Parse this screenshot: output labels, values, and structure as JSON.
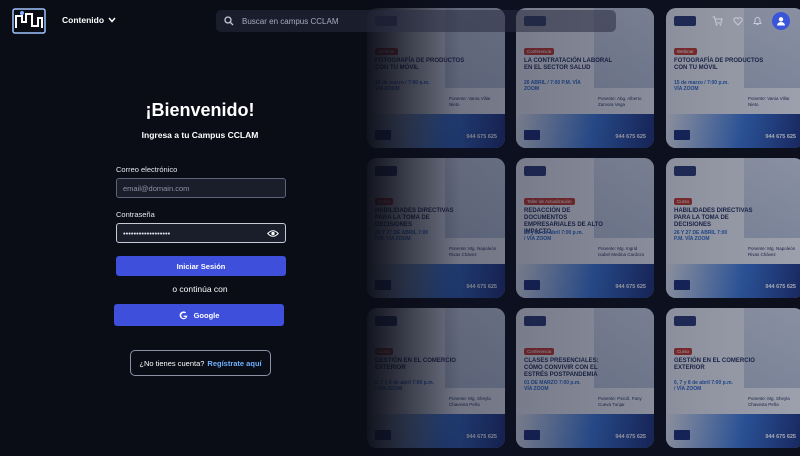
{
  "header": {
    "menu_label": "Contenido",
    "search_placeholder": "Buscar en campus CCLAM"
  },
  "login": {
    "title": "¡Bienvenido!",
    "subtitle": "Ingresa a tu Campus CCLAM",
    "email_label": "Correo electrónico",
    "email_placeholder": "email@domain.com",
    "password_label": "Contraseña",
    "password_value": "••••••••••••••••••",
    "submit_label": "Iniciar Sesión",
    "or_label": "o continúa con",
    "google_label": "Google",
    "signup_prompt": "¿No tienes cuenta?",
    "signup_link": "Regístrate aquí"
  },
  "cards": [
    {
      "tag": "Webinar",
      "title": "FOTOGRAFÍA DE PRODUCTOS CON TU MÓVIL",
      "date": "15 de marzo / 7:00 p.m. VÍA ZOOM",
      "speaker": "Ponente: Vania Villar Nieto",
      "phone": "944 675 625"
    },
    {
      "tag": "Conferencia",
      "title": "LA CONTRATACIÓN LABORAL EN EL SECTOR SALUD",
      "date": "26 ABRIL / 7:00 P.M. VÍA ZOOM",
      "speaker": "Ponente: Abg. Alberto Zamora Vega",
      "phone": "944 675 625"
    },
    {
      "tag": "Webinar",
      "title": "FOTOGRAFÍA DE PRODUCTOS CON TU MÓVIL",
      "date": "15 de marzo / 7:00 p.m. VÍA ZOOM",
      "speaker": "Ponente: Vania Villar Nieto",
      "phone": "944 675 625"
    },
    {
      "tag": "Curso",
      "title": "HABILIDADES DIRECTIVAS PARA LA TOMA DE DECISIONES",
      "date": "26 Y 27 DE ABRIL 7:00 P.M. VÍA ZOOM",
      "speaker": "Ponente: Mg. Napoleón Rivas Chávez",
      "phone": "944 675 625"
    },
    {
      "tag": "Taller de Actualización",
      "title": "REDACCIÓN DE DOCUMENTOS EMPRESARIALES DE ALTO IMPACTO",
      "date": "21 y 22 de abril 7:00 p.m. / VÍA ZOOM",
      "speaker": "Ponente: Mg. Ingrid Isabel Medina Cardozo",
      "phone": "944 675 625"
    },
    {
      "tag": "Curso",
      "title": "HABILIDADES DIRECTIVAS PARA LA TOMA DE DECISIONES",
      "date": "26 Y 27 DE ABRIL 7:00 P.M. VÍA ZOOM",
      "speaker": "Ponente: Mg. Napoleón Rivas Chávez",
      "phone": "944 675 625"
    },
    {
      "tag": "Curso",
      "title": "GESTIÓN EN EL COMERCIO EXTERIOR",
      "date": "6, 7 y 8 de abril 7:00 p.m. / VÍA ZOOM",
      "speaker": "Ponente: Mg. Sheyla Chavesta Peña",
      "phone": "944 675 625"
    },
    {
      "tag": "Conferencia",
      "title": "CLASES PRESENCIALES: CÓMO CONVIVIR CON EL ESTRÉS POSTPANDEMIA",
      "date": "01 DE MARZO 7:00 p.m. VÍA ZOOM",
      "speaker": "Ponente: Psicól. Fany Cueva Tunjar",
      "phone": "944 675 625"
    },
    {
      "tag": "Curso",
      "title": "GESTIÓN EN EL COMERCIO EXTERIOR",
      "date": "6, 7 y 8 de abril 7:00 p.m. / VÍA ZOOM",
      "speaker": "Ponente: Mg. Sheyla Chavesta Peña",
      "phone": "944 675 625"
    }
  ],
  "colors": {
    "accent": "#3d4fdb",
    "link": "#6fb2ff",
    "background": "#0c0e16"
  }
}
